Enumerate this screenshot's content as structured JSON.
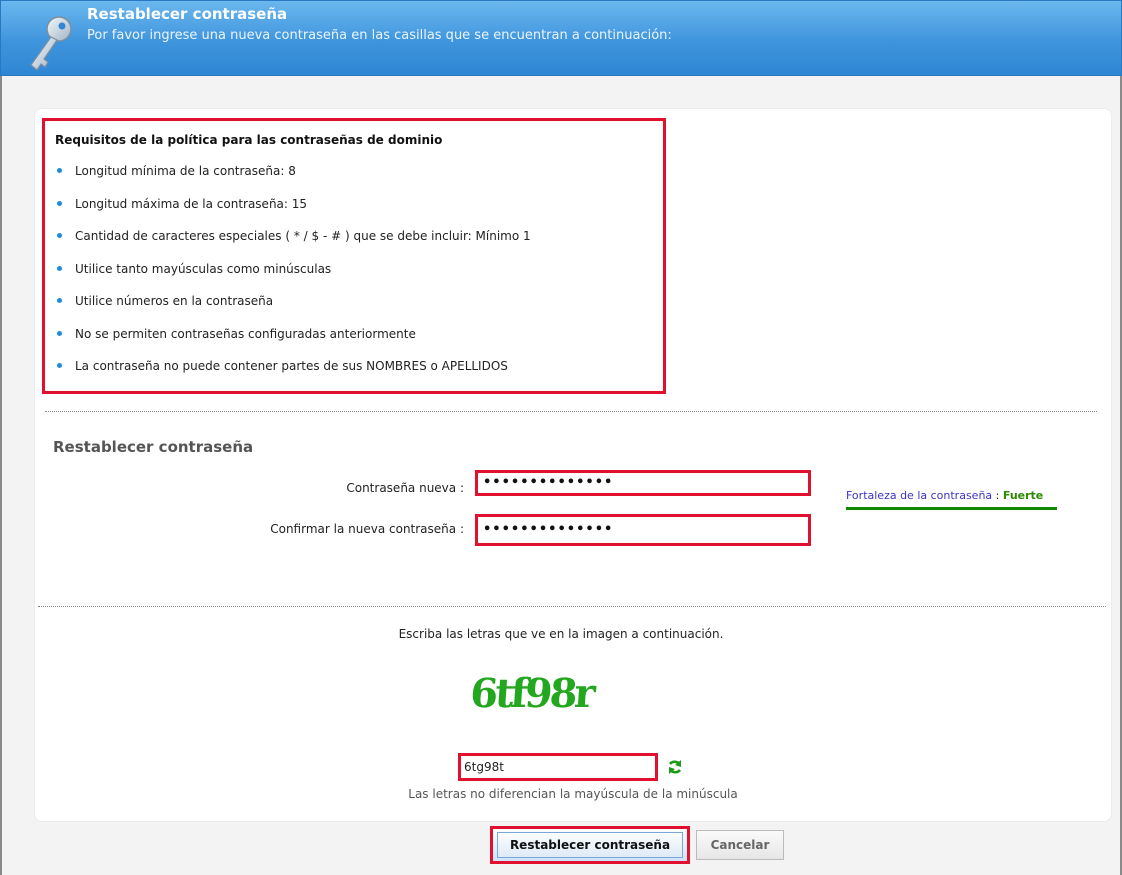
{
  "header": {
    "title": "Restablecer contraseña",
    "subtitle": "Por favor ingrese una nueva contraseña en las casillas que se encuentran a continuación:",
    "icon": "key-icon"
  },
  "requirements": {
    "title": "Requisitos de la política para las contraseñas de dominio",
    "items": [
      "Longitud mínima de la contraseña: 8",
      "Longitud máxima de la contraseña: 15",
      "Cantidad de caracteres especiales ( * / $ - # ) que se debe incluir: Mínimo 1",
      "Utilice tanto mayúsculas como minúsculas",
      "Utilice números en la contraseña",
      "No se permiten contraseñas configuradas anteriormente",
      "La contraseña no puede contener partes de sus NOMBRES o APELLIDOS"
    ]
  },
  "reset_form": {
    "section_title": "Restablecer contraseña",
    "new_password_label": "Contraseña nueva :",
    "new_password_value": "••••••••••••••",
    "confirm_password_label": "Confirmar la nueva contraseña :",
    "confirm_password_value": "••••••••••••••",
    "strength_label": "Fortaleza de la contraseña",
    "strength_separator": " : ",
    "strength_value": "Fuerte"
  },
  "captcha": {
    "instruction": "Escriba las letras que ve en la imagen a continuación.",
    "image_text": "6tf98r",
    "input_value": "6tg98t",
    "note": "Las letras no diferencian la mayúscula de la minúscula",
    "refresh_icon": "refresh-icon"
  },
  "buttons": {
    "submit": "Restablecer contraseña",
    "cancel": "Cancelar"
  },
  "colors": {
    "header_blue": "#3f95dc",
    "highlight_red": "#e2102f",
    "strength_green": "#2a8a00",
    "bullet_blue": "#1f8be0"
  }
}
